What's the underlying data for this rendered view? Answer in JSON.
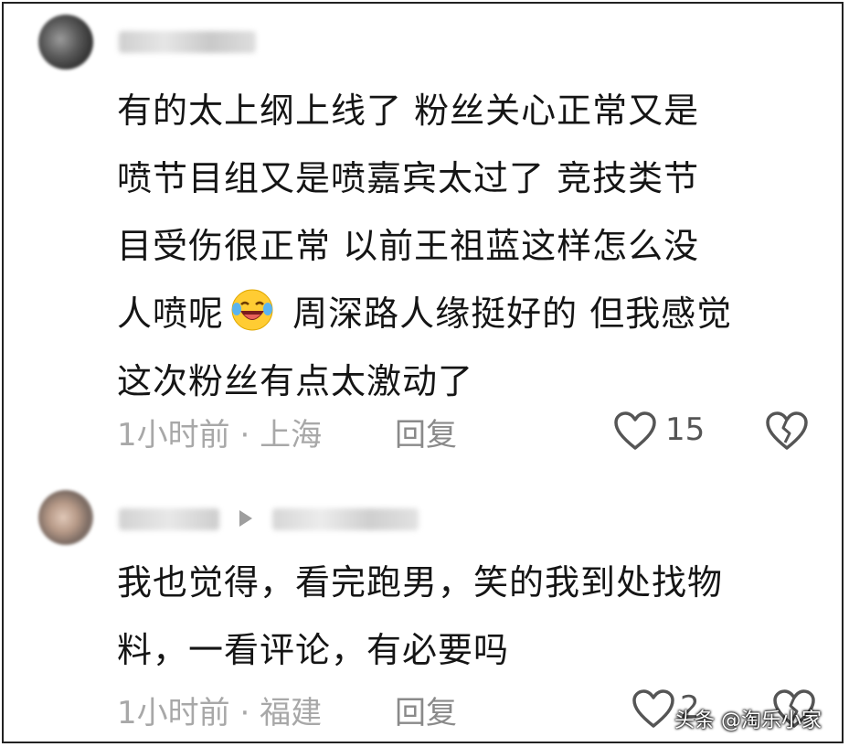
{
  "comments": [
    {
      "lines": [
        "有的太上纲上线了 粉丝关心正常又是",
        "喷节目组又是喷嘉宾太过了 竞技类节",
        "目受伤很正常 以前王祖蓝这样怎么没"
      ],
      "line4_before": "人喷呢",
      "emoji": "laughing-crying-emoji",
      "line4_after": " 周深路人缘挺好的 但我感觉",
      "line5": "这次粉丝有点太激动了",
      "time": "1小时前",
      "location": "上海",
      "reply_label": "回复",
      "likes": "15"
    },
    {
      "lines": [
        "我也觉得，看完跑男，笑的我到处找物",
        "料，一看评论，有必要吗"
      ],
      "time": "1小时前",
      "location": "福建",
      "reply_label": "回复",
      "likes": "2"
    }
  ],
  "separator": " · ",
  "watermark": "头条 @淘乐小家",
  "colors": {
    "text": "#151515",
    "meta": "#a8a8a8",
    "icon": "#555555"
  }
}
